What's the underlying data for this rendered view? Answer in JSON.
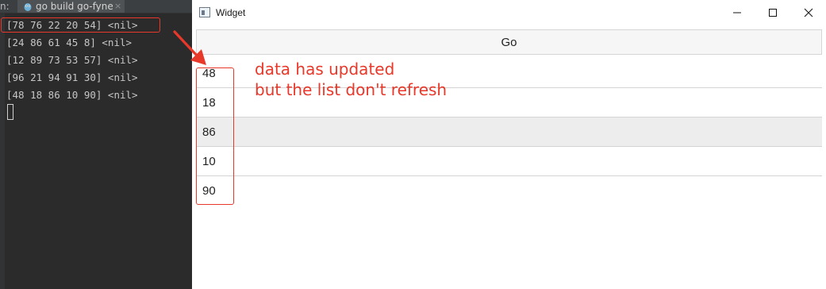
{
  "ide": {
    "prefix": "n:",
    "tab_title": "go build go-fyne",
    "tab_close": "×",
    "console_lines": [
      "[78 76 22 20 54] <nil>",
      "[24 86 61 45 8] <nil>",
      "[12 89 73 53 57] <nil>",
      "[96 21 94 91 30] <nil>",
      "[48 18 86 10 90] <nil>"
    ]
  },
  "window": {
    "title": "Widget",
    "go_button_label": "Go",
    "list_items": [
      "48",
      "18",
      "86",
      "10",
      "90"
    ]
  },
  "annotation": {
    "line1": "data has updated",
    "line2": "but the list don't refresh",
    "color": "#e8382a"
  },
  "colors": {
    "ide_bg": "#2b2b2b",
    "highlight": "#e8382a",
    "list_hover": "#ededed"
  },
  "icons": [
    "go-gopher-icon",
    "app-window-icon",
    "minimize-icon",
    "maximize-icon",
    "close-icon",
    "arrow-icon"
  ]
}
